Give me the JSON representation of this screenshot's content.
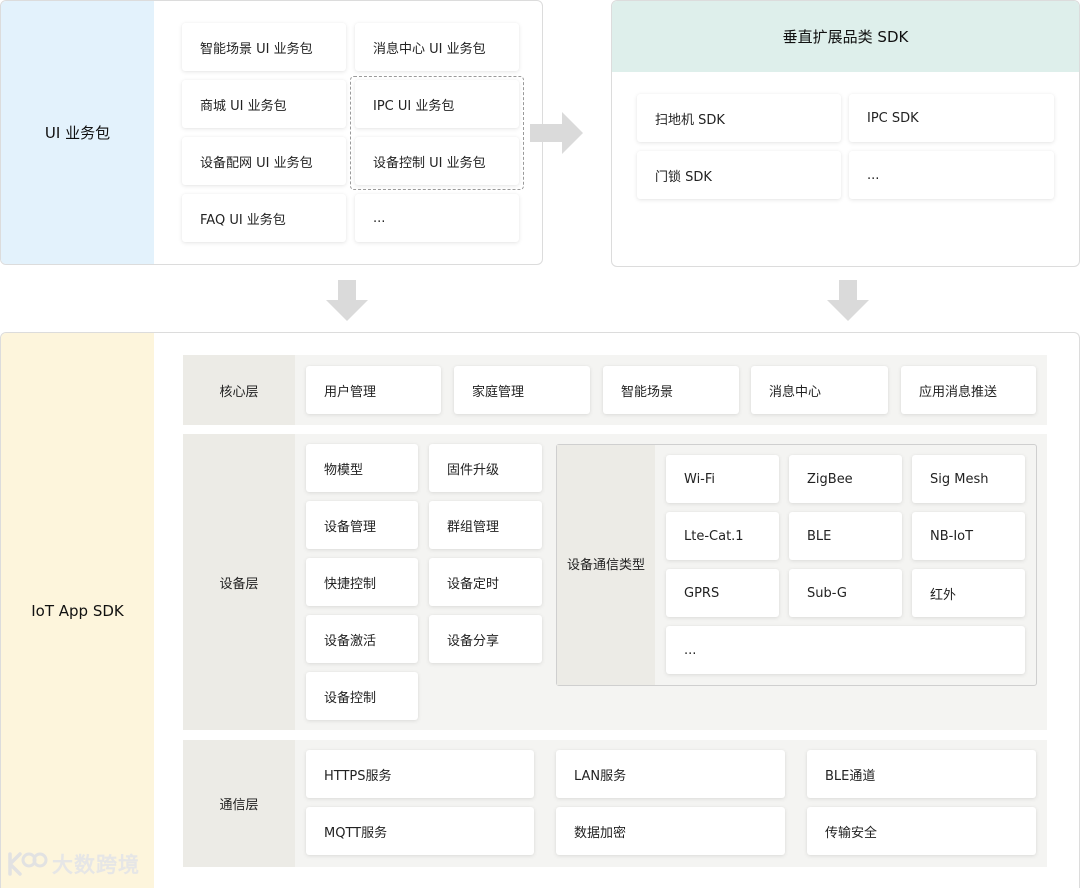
{
  "ui_package": {
    "title": "UI 业务包",
    "items": [
      "智能场景 UI 业务包",
      "消息中心 UI 业务包",
      "商城 UI 业务包",
      "IPC UI 业务包",
      "设备配网 UI 业务包",
      "设备控制 UI 业务包",
      "FAQ UI 业务包",
      "..."
    ]
  },
  "vertical_sdk": {
    "title": "垂直扩展品类 SDK",
    "items": [
      "扫地机 SDK",
      "IPC SDK",
      "门锁 SDK",
      "..."
    ]
  },
  "iot_sdk": {
    "title": "IoT App SDK",
    "core": {
      "label": "核心层",
      "items": [
        "用户管理",
        "家庭管理",
        "智能场景",
        "消息中心",
        "应用消息推送"
      ]
    },
    "device": {
      "label": "设备层",
      "items": [
        "物模型",
        "固件升级",
        "设备管理",
        "群组管理",
        "快捷控制",
        "设备定时",
        "设备激活",
        "设备分享",
        "设备控制"
      ],
      "comm_types": {
        "label_line1": "设备通信",
        "label_line2": "类型",
        "items": [
          "Wi-Fi",
          "ZigBee",
          "Sig Mesh",
          "Lte-Cat.1",
          "BLE",
          "NB-IoT",
          "GPRS",
          "Sub-G",
          "红外",
          "..."
        ]
      }
    },
    "comm": {
      "label": "通信层",
      "items": [
        "HTTPS服务",
        "LAN服务",
        "BLE通道",
        "MQTT服务",
        "数据加密",
        "传输安全"
      ]
    }
  },
  "watermark": "大数跨境",
  "colors": {
    "ui_side": "#e3f2fc",
    "sdk_side": "#fdf5dc",
    "teal_header": "#deefeb",
    "arrow": "#d8d8d8"
  }
}
